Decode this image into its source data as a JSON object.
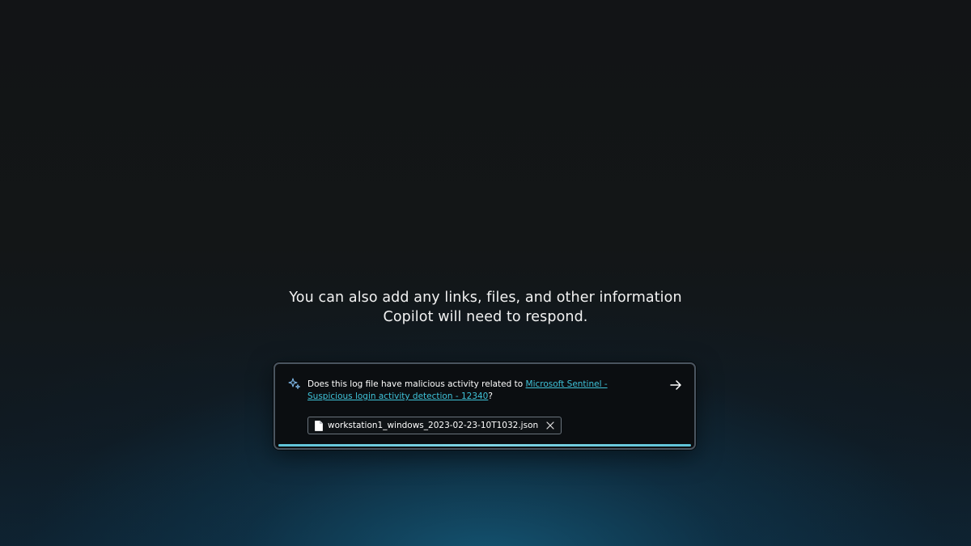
{
  "intro": {
    "line1": "You can also add any links, files, and other information",
    "line2": "Copilot will need to respond."
  },
  "prompt": {
    "text_before_link": "Does this log file have malicious activity related to ",
    "link_text": "Microsoft Sentinel -Suspicious login activity detection - 12340",
    "text_after_link": "?",
    "submit_icon": "arrow-right-icon",
    "sparkle_icon": "copilot-sparkle-icon"
  },
  "attachment": {
    "file_name": "workstation1_windows_2023-02-23-10T1032.json",
    "file_icon": "document-icon",
    "remove_icon": "close-icon"
  },
  "colors": {
    "link": "#3fc3d9",
    "accent_bar": "#5fc3d8",
    "text": "#ffffff"
  }
}
